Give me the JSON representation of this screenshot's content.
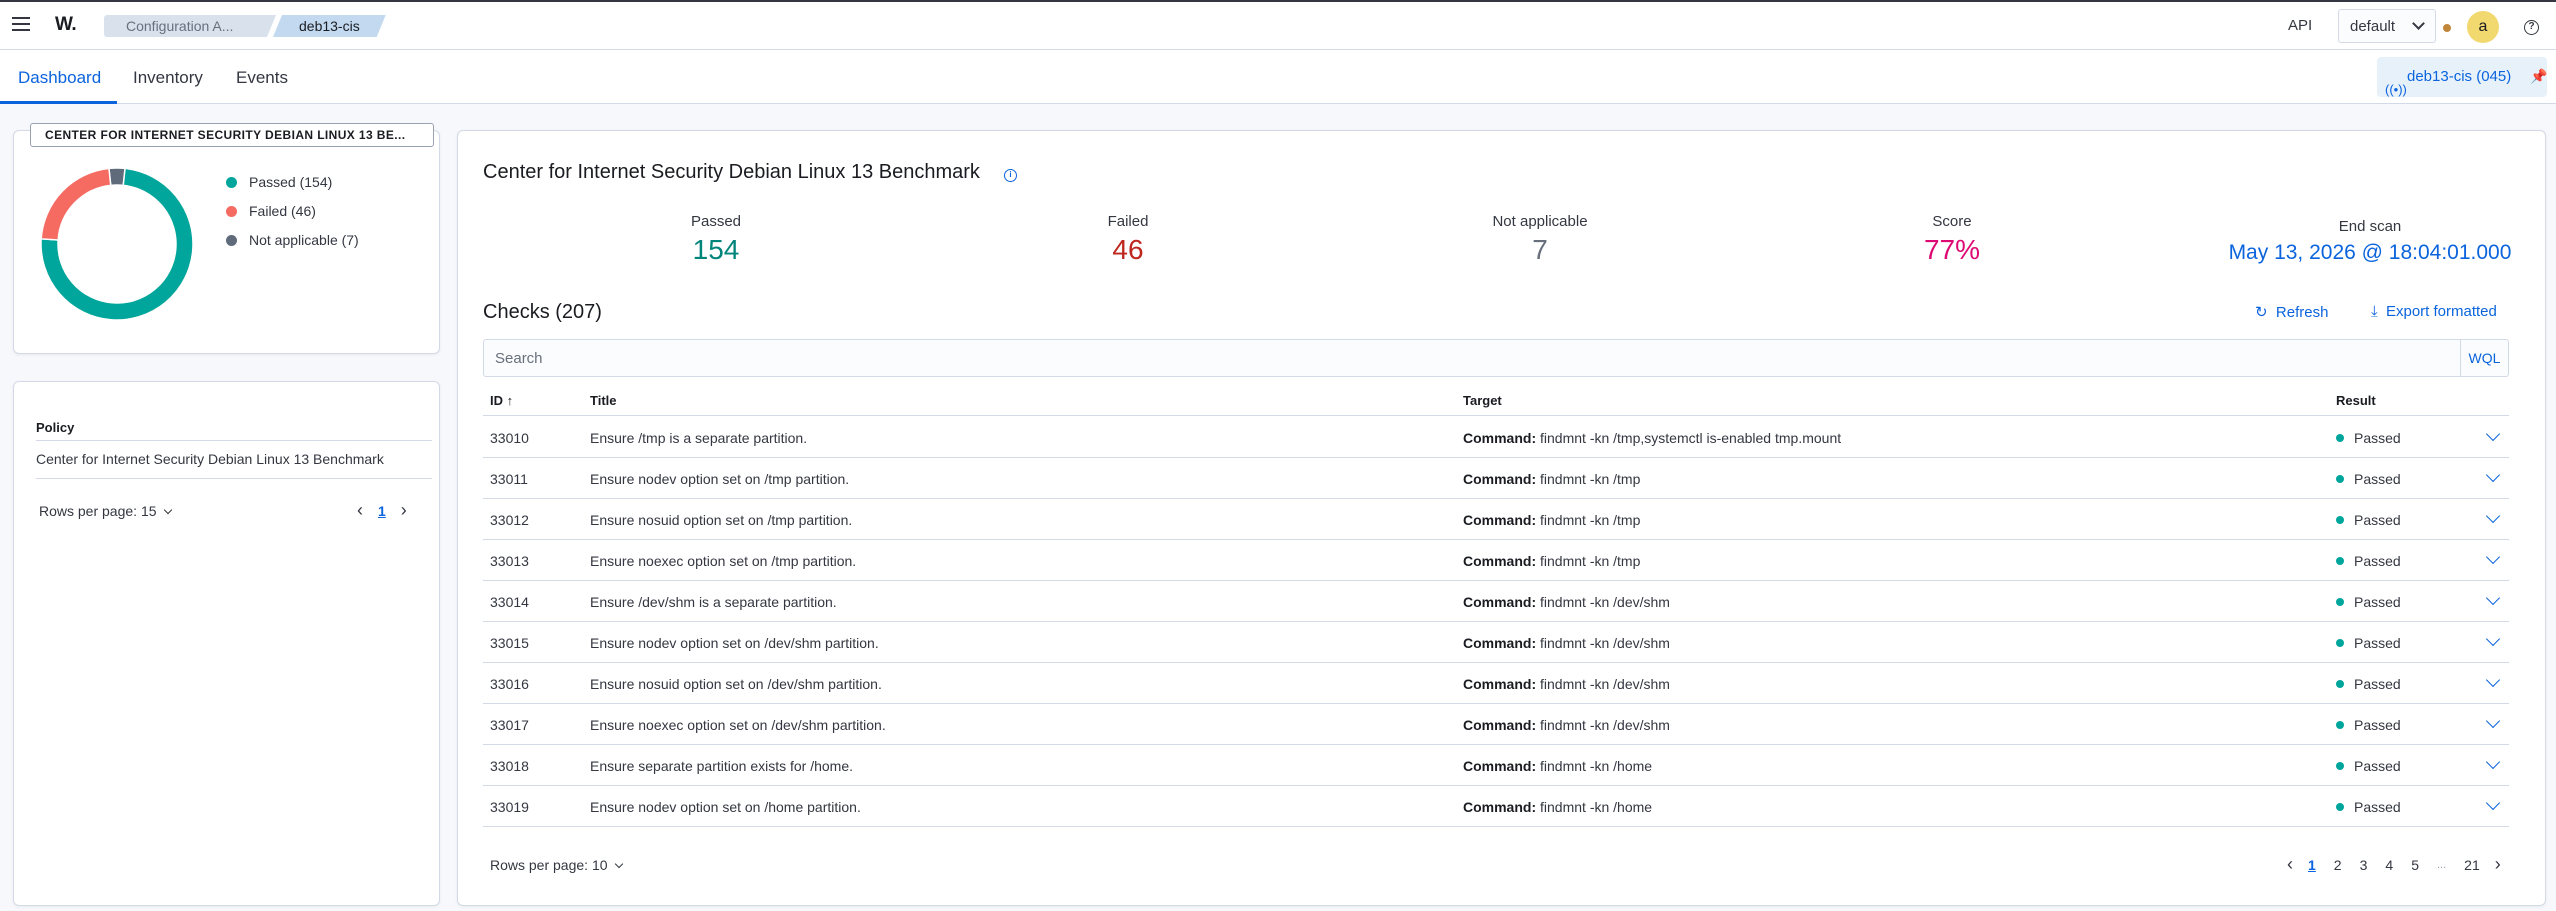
{
  "header": {
    "logo": "W.",
    "breadcrumbs": [
      "Configuration A...",
      "deb13-cis"
    ],
    "api_label": "API",
    "env_select": "default",
    "avatar_letter": "a",
    "help": "?"
  },
  "tabs": [
    "Dashboard",
    "Inventory",
    "Events"
  ],
  "agent_badge": "deb13-cis (045)",
  "summary": {
    "title": "CENTER FOR INTERNET SECURITY DEBIAN LINUX 13 BE...",
    "legend": [
      "Passed (154)",
      "Failed (46)",
      "Not applicable (7)"
    ],
    "colors": {
      "passed": "#00a69b",
      "failed": "#f66b61",
      "na": "#5f6b7a"
    },
    "counts": {
      "passed": 154,
      "failed": 46,
      "na": 7
    }
  },
  "policy_panel": {
    "header": "Policy",
    "row": "Center for Internet Security Debian Linux 13 Benchmark",
    "rows_per_page": "Rows per page: 15",
    "page": "1"
  },
  "benchmark": {
    "title": "Center for Internet Security Debian Linux 13 Benchmark",
    "stats": [
      {
        "label": "Passed",
        "value": "154",
        "color": "#00857a"
      },
      {
        "label": "Failed",
        "value": "46",
        "color": "#bd271e"
      },
      {
        "label": "Not applicable",
        "value": "7",
        "color": "#69707d"
      },
      {
        "label": "Score",
        "value": "77%",
        "color": "#dd0a73"
      },
      {
        "label": "End scan",
        "value": "May 13, 2026 @ 18:04:01.000",
        "color": "#0b64dd"
      }
    ]
  },
  "checks": {
    "title": "Checks (207)",
    "refresh": "Refresh",
    "export": "Export formatted",
    "search_placeholder": "Search",
    "wql": "WQL",
    "columns": [
      "ID",
      "Title",
      "Target",
      "Result"
    ],
    "target_prefix": "Command:",
    "rows": [
      {
        "id": "33010",
        "title": "Ensure /tmp is a separate partition.",
        "target": "findmnt -kn /tmp,systemctl is-enabled tmp.mount",
        "result": "Passed"
      },
      {
        "id": "33011",
        "title": "Ensure nodev option set on /tmp partition.",
        "target": "findmnt -kn /tmp",
        "result": "Passed"
      },
      {
        "id": "33012",
        "title": "Ensure nosuid option set on /tmp partition.",
        "target": "findmnt -kn /tmp",
        "result": "Passed"
      },
      {
        "id": "33013",
        "title": "Ensure noexec option set on /tmp partition.",
        "target": "findmnt -kn /tmp",
        "result": "Passed"
      },
      {
        "id": "33014",
        "title": "Ensure /dev/shm is a separate partition.",
        "target": "findmnt -kn /dev/shm",
        "result": "Passed"
      },
      {
        "id": "33015",
        "title": "Ensure nodev option set on /dev/shm partition.",
        "target": "findmnt -kn /dev/shm",
        "result": "Passed"
      },
      {
        "id": "33016",
        "title": "Ensure nosuid option set on /dev/shm partition.",
        "target": "findmnt -kn /dev/shm",
        "result": "Passed"
      },
      {
        "id": "33017",
        "title": "Ensure noexec option set on /dev/shm partition.",
        "target": "findmnt -kn /dev/shm",
        "result": "Passed"
      },
      {
        "id": "33018",
        "title": "Ensure separate partition exists for /home.",
        "target": "findmnt -kn /home",
        "result": "Passed"
      },
      {
        "id": "33019",
        "title": "Ensure nodev option set on /home partition.",
        "target": "findmnt -kn /home",
        "result": "Passed"
      }
    ],
    "rows_per_page": "Rows per page: 10",
    "pages": [
      "1",
      "2",
      "3",
      "4",
      "5",
      "...",
      "21"
    ]
  }
}
